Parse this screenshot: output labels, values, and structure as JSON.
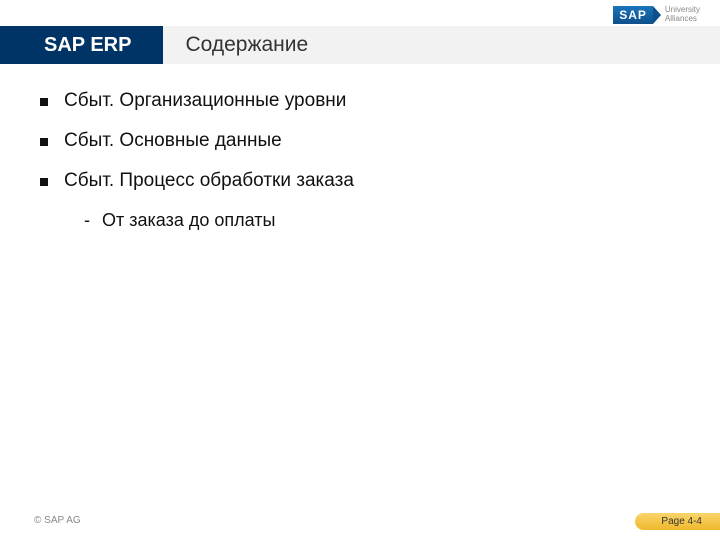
{
  "header": {
    "logo_text": "SAP",
    "logo_subtitle_line1": "University",
    "logo_subtitle_line2": "Alliances"
  },
  "title_bar": {
    "badge": "SAP ERP",
    "title": "Содержание"
  },
  "content": {
    "bullets": [
      {
        "text": "Сбыт. Организационные уровни"
      },
      {
        "text": "Сбыт. Основные данные"
      },
      {
        "text": "Сбыт. Процесс обработки заказа"
      }
    ],
    "sub_bullet": "От заказа до оплаты"
  },
  "footer": {
    "copyright": "© SAP AG",
    "page": "Page 4-4"
  }
}
